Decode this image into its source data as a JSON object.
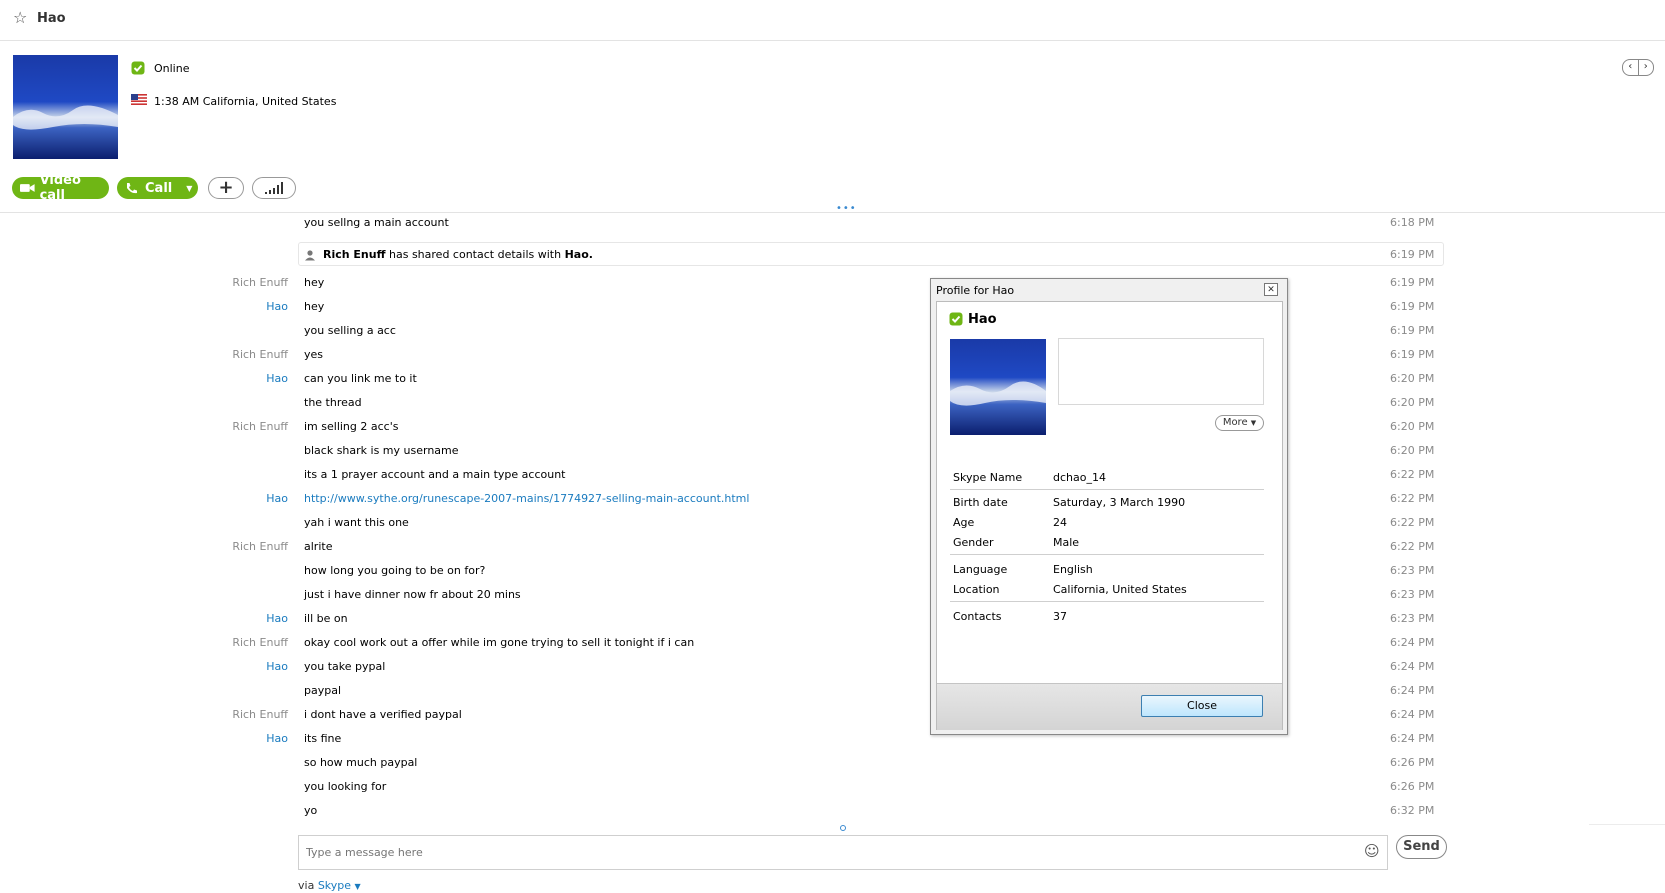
{
  "header": {
    "contact_name": "Hao"
  },
  "profile_summary": {
    "status": "Online",
    "local_time": "1:38 AM California, United States"
  },
  "actions": {
    "video_call": "Video call",
    "call": "Call"
  },
  "share_notice": {
    "sender": "Rich Enuff",
    "middle": " has shared contact details with ",
    "target": "Hao.",
    "time": "6:19 PM"
  },
  "messages": [
    {
      "sender": "",
      "text": "you sellng a main account",
      "time": "6:18 PM"
    },
    {
      "sender": "Rich Enuff",
      "text": "hey",
      "time": "6:19 PM"
    },
    {
      "sender": "Hao",
      "text": "hey",
      "time": "6:19 PM"
    },
    {
      "sender": "",
      "text": "you selling a acc",
      "time": "6:19 PM"
    },
    {
      "sender": "Rich Enuff",
      "text": "yes",
      "time": "6:19 PM"
    },
    {
      "sender": "Hao",
      "text": "can you link me to it",
      "time": "6:20 PM"
    },
    {
      "sender": "",
      "text": "the thread",
      "time": "6:20 PM"
    },
    {
      "sender": "Rich Enuff",
      "text": "im selling 2 acc's",
      "time": "6:20 PM"
    },
    {
      "sender": "",
      "text": "black shark is my username",
      "time": "6:20 PM"
    },
    {
      "sender": "",
      "text": "its a 1 prayer account and a main type account",
      "time": "6:22 PM"
    },
    {
      "sender": "Hao",
      "text": "http://www.sythe.org/runescape-2007-mains/1774927-selling-main-account.html",
      "time": "6:22 PM",
      "link": true
    },
    {
      "sender": "",
      "text": "yah i want this one",
      "time": "6:22 PM"
    },
    {
      "sender": "Rich Enuff",
      "text": "alrite",
      "time": "6:22 PM"
    },
    {
      "sender": "",
      "text": "how long you going to be on for?",
      "time": "6:23 PM"
    },
    {
      "sender": "",
      "text": "just i have dinner now fr about 20 mins",
      "time": "6:23 PM"
    },
    {
      "sender": "Hao",
      "text": "ill be on",
      "time": "6:23 PM"
    },
    {
      "sender": "Rich Enuff",
      "text": "okay cool work out a offer while im gone trying to sell it tonight if i can",
      "time": "6:24 PM"
    },
    {
      "sender": "Hao",
      "text": "you take pypal",
      "time": "6:24 PM"
    },
    {
      "sender": "",
      "text": "paypal",
      "time": "6:24 PM"
    },
    {
      "sender": "Rich Enuff",
      "text": "i dont have a verified paypal",
      "time": "6:24 PM"
    },
    {
      "sender": "Hao",
      "text": "its fine",
      "time": "6:24 PM"
    },
    {
      "sender": "",
      "text": "so how much paypal",
      "time": "6:26 PM"
    },
    {
      "sender": "",
      "text": "you looking for",
      "time": "6:26 PM"
    },
    {
      "sender": "",
      "text": "yo",
      "time": "6:32 PM"
    }
  ],
  "composer": {
    "placeholder": "Type a message here",
    "send": "Send",
    "via_prefix": "via ",
    "via_service": "Skype"
  },
  "profile_dialog": {
    "title": "Profile for Hao",
    "name": "Hao",
    "more": "More",
    "close": "Close",
    "fields": {
      "skype_name_label": "Skype Name",
      "skype_name": "dchao_14",
      "birth_date_label": "Birth date",
      "birth_date": "Saturday, 3 March 1990",
      "age_label": "Age",
      "age": "24",
      "gender_label": "Gender",
      "gender": "Male",
      "language_label": "Language",
      "language": "English",
      "location_label": "Location",
      "location": "California, United States",
      "contacts_label": "Contacts",
      "contacts": "37"
    }
  },
  "colors": {
    "accent_green": "#6fb615",
    "link_blue": "#1a7bbf",
    "muted_gray": "#8a8a8a"
  },
  "icons": [
    "star-icon",
    "online-status-icon",
    "us-flag-icon",
    "video-camera-icon",
    "phone-icon",
    "chevron-down-icon",
    "plus-icon",
    "signal-bars-icon",
    "chevron-left-icon",
    "chevron-right-icon",
    "contact-card-icon",
    "emoji-icon",
    "close-icon"
  ]
}
